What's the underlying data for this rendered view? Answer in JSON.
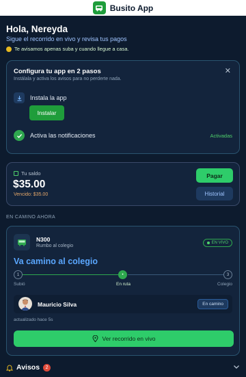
{
  "header": {
    "app_name": "Busito App",
    "logo_icon": "bus-icon"
  },
  "greeting": {
    "title": "Hola, Nereyda",
    "subtitle": "Sigue el recorrido en vivo y revisa tus pagos",
    "note": "Te avisamos apenas suba y cuando llegue a casa."
  },
  "setup": {
    "title": "Configura tu app en 2 pasos",
    "description": "Instálala y activa los avisos para no perderte nada.",
    "step1_label": "Instala la app",
    "install_button": "Instalar",
    "step2_label": "Activa las notificaciones",
    "step2_status": "Activadas"
  },
  "balance": {
    "label": "Tu saldo",
    "amount": "$35.00",
    "due": "Vencido: $35.00",
    "pay_button": "Pagar",
    "history_button": "Historial"
  },
  "section_label": "EN CAMINO AHORA",
  "trip": {
    "route": "N300",
    "route_subtitle": "Rumbo al colegio",
    "live_badge": "EN VIVO",
    "headline": "Va camino al colegio",
    "steps": [
      {
        "num": "1",
        "label": "Subió",
        "state": "done"
      },
      {
        "num": "•",
        "label": "En ruta",
        "state": "active"
      },
      {
        "num": "3",
        "label": "Colegio",
        "state": "pending"
      }
    ],
    "driver_name": "Mauricio Silva",
    "driver_status": "En camino",
    "updated": "actualizado hace 5s",
    "route_button": "Ver recorrido en vivo"
  },
  "alerts": {
    "title": "Avisos",
    "count": "2"
  },
  "colors": {
    "accent_green": "#2ecc6a",
    "accent_blue": "#5aa7ff",
    "background": "#0d1b2e",
    "danger": "#e04a3a"
  }
}
